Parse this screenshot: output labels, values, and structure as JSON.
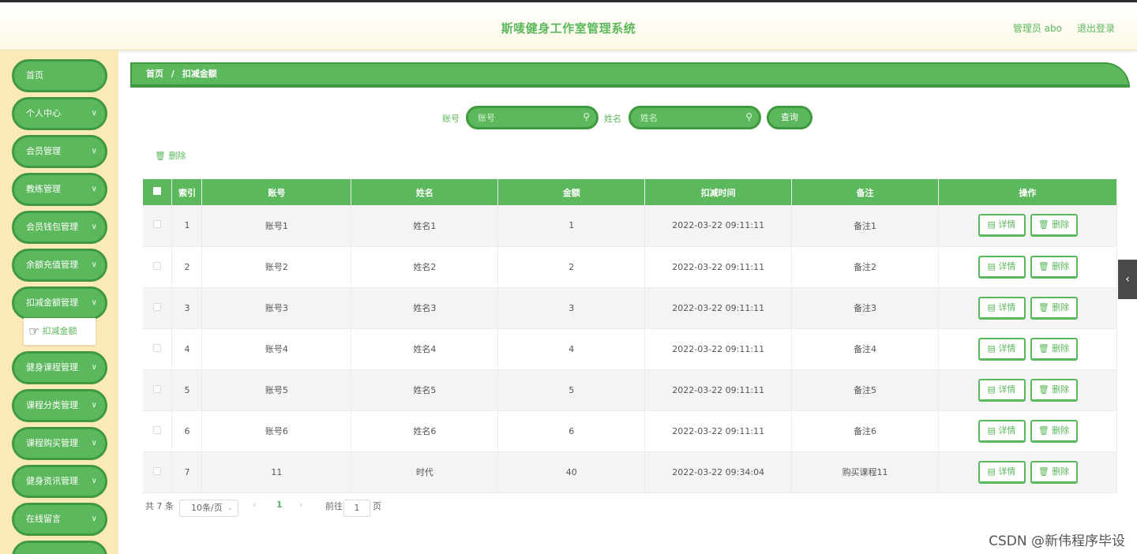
{
  "header": {
    "title": "斯唛健身工作室管理系统",
    "admin": "管理员 abo",
    "logout": "退出登录"
  },
  "sidebar": {
    "items": [
      {
        "label": "首页",
        "chevron": false
      },
      {
        "label": "个人中心",
        "chevron": true
      },
      {
        "label": "会员管理",
        "chevron": true
      },
      {
        "label": "教练管理",
        "chevron": true
      },
      {
        "label": "会员钱包管理",
        "chevron": true
      },
      {
        "label": "余额充值管理",
        "chevron": true
      },
      {
        "label": "扣减金额管理",
        "chevron": true
      },
      {
        "label": "健身课程管理",
        "chevron": true
      },
      {
        "label": "课程分类管理",
        "chevron": true
      },
      {
        "label": "课程购买管理",
        "chevron": true
      },
      {
        "label": "健身资讯管理",
        "chevron": true
      },
      {
        "label": "在线留言",
        "chevron": true
      }
    ],
    "submenu": "扣减金额"
  },
  "breadcrumb": {
    "home": "首页",
    "separator": "/",
    "current": "扣减金额"
  },
  "search": {
    "account_label": "账号",
    "account_placeholder": "账号",
    "name_label": "姓名",
    "name_placeholder": "姓名",
    "query_label": "查询"
  },
  "toolbar": {
    "delete_label": "删除"
  },
  "table": {
    "headers": [
      "索引",
      "账号",
      "姓名",
      "金额",
      "扣减时间",
      "备注",
      "操作"
    ],
    "rows": [
      {
        "index": "1",
        "account": "账号1",
        "name": "姓名1",
        "amount": "1",
        "time": "2022-03-22 09:11:11",
        "remark": "备注1"
      },
      {
        "index": "2",
        "account": "账号2",
        "name": "姓名2",
        "amount": "2",
        "time": "2022-03-22 09:11:11",
        "remark": "备注2"
      },
      {
        "index": "3",
        "account": "账号3",
        "name": "姓名3",
        "amount": "3",
        "time": "2022-03-22 09:11:11",
        "remark": "备注3"
      },
      {
        "index": "4",
        "account": "账号4",
        "name": "姓名4",
        "amount": "4",
        "time": "2022-03-22 09:11:11",
        "remark": "备注4"
      },
      {
        "index": "5",
        "account": "账号5",
        "name": "姓名5",
        "amount": "5",
        "time": "2022-03-22 09:11:11",
        "remark": "备注5"
      },
      {
        "index": "6",
        "account": "账号6",
        "name": "姓名6",
        "amount": "6",
        "time": "2022-03-22 09:11:11",
        "remark": "备注6"
      },
      {
        "index": "7",
        "account": "11",
        "name": "时代",
        "amount": "40",
        "time": "2022-03-22 09:34:04",
        "remark": "购买课程11"
      }
    ],
    "detail_label": "详情",
    "delete_label": "删除"
  },
  "pagination": {
    "total": "共 7 条",
    "page_size": "10条/页",
    "current_page": "1",
    "goto_label": "前往",
    "goto_value": "1",
    "page_suffix": "页"
  },
  "watermark": "CSDN @新伟程序毕设",
  "colors": {
    "accent": "#5cb85c",
    "accent_dark": "#3f9a3f",
    "sidebar_bg": "#fce9b8"
  }
}
